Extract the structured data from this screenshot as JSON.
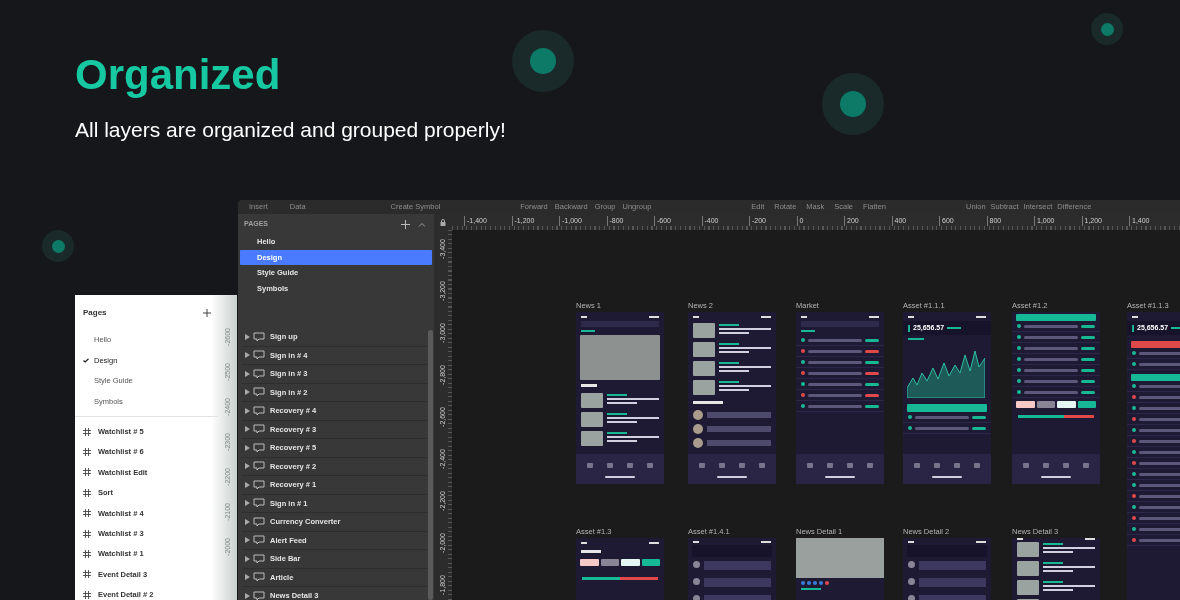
{
  "hero": {
    "title": "Organized",
    "subtitle": "All layers are organized and grouped properly!"
  },
  "toolbar": {
    "groups": [
      [
        "Insert",
        "Data"
      ],
      [
        "Create Symbol"
      ],
      [
        "Forward",
        "Backward",
        "Group",
        "Ungroup"
      ],
      [
        "Edit",
        "Rotate",
        "Mask",
        "Scale",
        "Flatten"
      ],
      [
        "Union",
        "Subtract",
        "Intersect",
        "Difference"
      ]
    ]
  },
  "pages_panel": {
    "header": "PAGES",
    "pages": [
      {
        "label": "Hello",
        "selected": false
      },
      {
        "label": "Design",
        "selected": true
      },
      {
        "label": "Style Guide",
        "selected": false
      },
      {
        "label": "Symbols",
        "selected": false
      }
    ],
    "layers": [
      "Sign up",
      "Sign in # 4",
      "Sign in # 3",
      "Sign in # 2",
      "Recovery # 4",
      "Recovery # 3",
      "Recovery # 5",
      "Recovery # 2",
      "Recovery # 1",
      "Sign in # 1",
      "Currency Converter",
      "Alert Feed",
      "Side Bar",
      "Article",
      "News Detail 3"
    ]
  },
  "ruler": {
    "x_labels": [
      "-1,400",
      "-1,200",
      "-1,000",
      "-800",
      "-600",
      "-400",
      "-200",
      "0",
      "200",
      "400",
      "600",
      "800",
      "1,000",
      "1,200",
      "1,400"
    ],
    "y_labels": [
      "-3,400",
      "-3,200",
      "-3,000",
      "-2,800",
      "-2,600",
      "-2,400",
      "-2,200",
      "-2,000",
      "-1,800"
    ]
  },
  "artboards": [
    {
      "title": "News 1",
      "kind": "news"
    },
    {
      "title": "News 2",
      "kind": "news-list"
    },
    {
      "title": "Market",
      "kind": "market"
    },
    {
      "title": "Asset #1.1.1",
      "kind": "chart",
      "price": "25,656.57"
    },
    {
      "title": "Asset #1.2",
      "kind": "stats"
    },
    {
      "title": "Asset #1.1.3",
      "kind": "tall",
      "price": "25,656.57"
    },
    {
      "title": "Asset #1.3",
      "kind": "technical"
    },
    {
      "title": "Asset #1.4.1",
      "kind": "comments"
    },
    {
      "title": "News Detail 1",
      "kind": "article"
    },
    {
      "title": "News Detail 2",
      "kind": "comments"
    },
    {
      "title": "News Detail 3",
      "kind": "news-list"
    }
  ],
  "figma_panel": {
    "header": "Pages",
    "pages": [
      {
        "label": "Hello",
        "selected": false
      },
      {
        "label": "Design",
        "selected": true
      },
      {
        "label": "Style Guide",
        "selected": false
      },
      {
        "label": "Symbols",
        "selected": false
      }
    ],
    "frames": [
      "Watchlist # 5",
      "Watchlist # 6",
      "Watchlist Edit",
      "Sort",
      "Watchlist # 4",
      "Watchlist # 3",
      "Watchlist # 1",
      "Event Detail 3",
      "Event Detail # 2"
    ],
    "ruler_labels": [
      "-2600",
      "-2500",
      "-2400",
      "-2300",
      "-2200",
      "-2100",
      "-2000"
    ]
  }
}
